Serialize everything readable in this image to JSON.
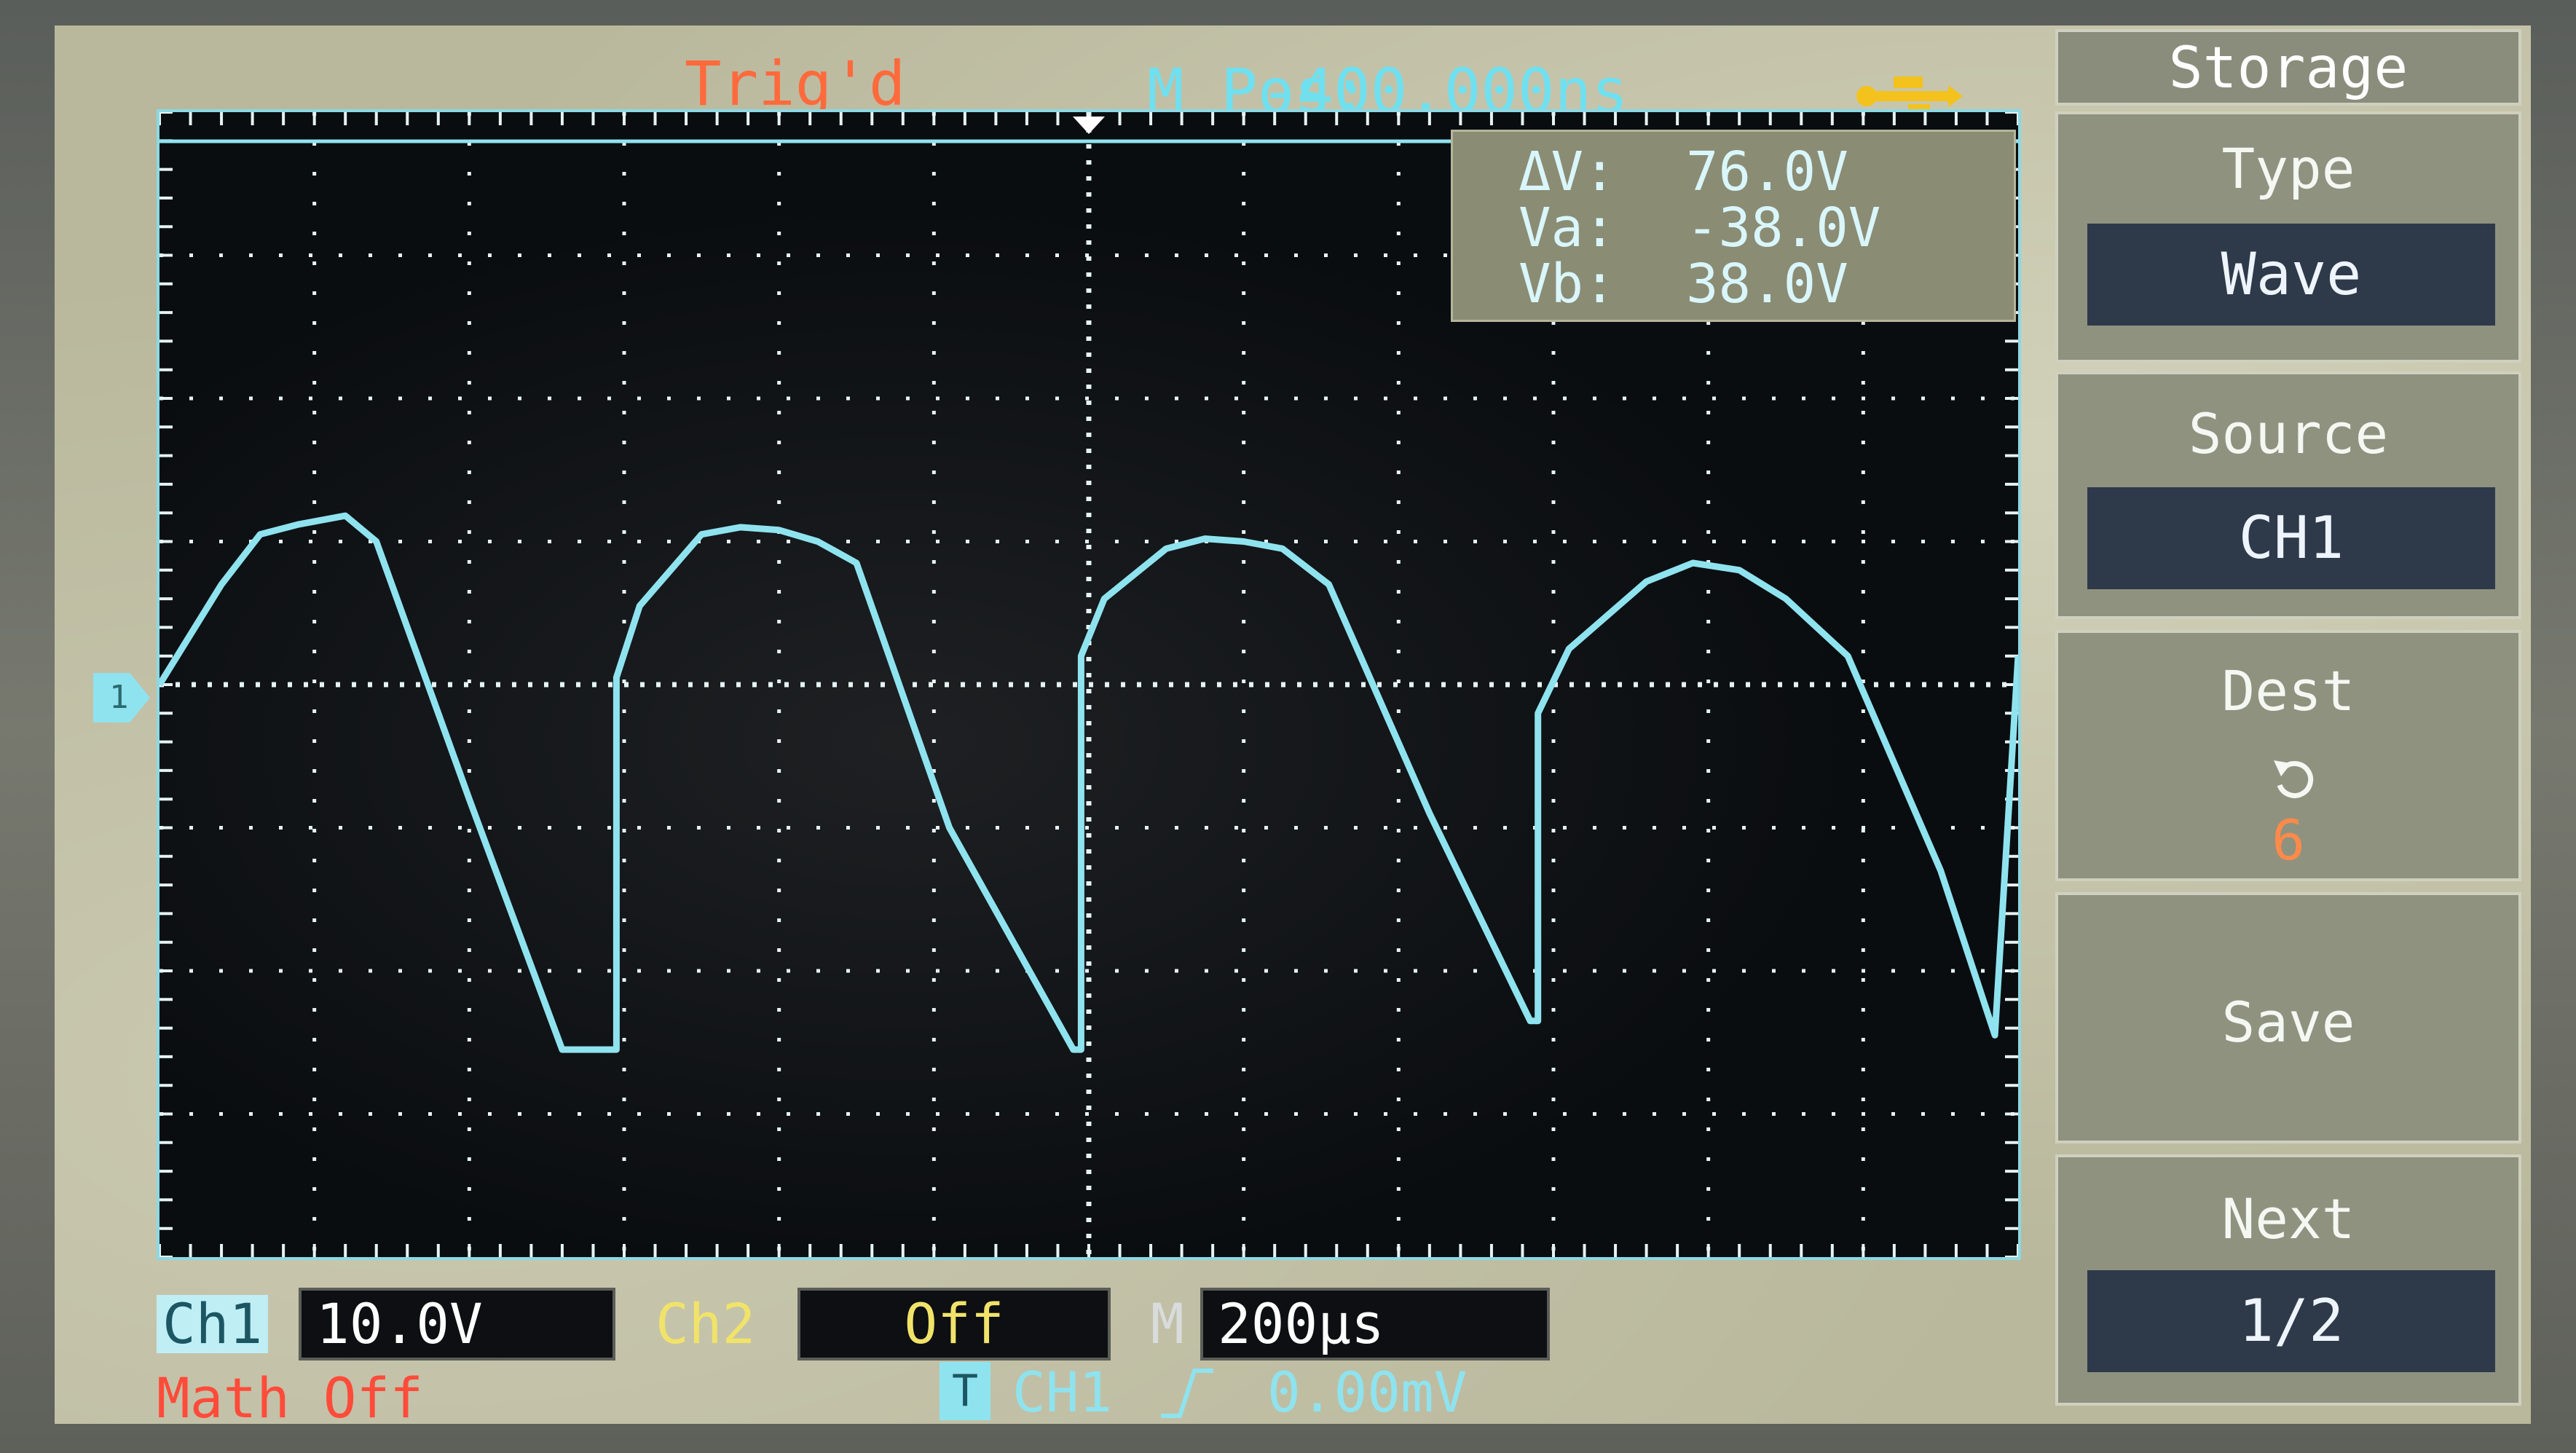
{
  "top_bar": {
    "trigger_status": "Trig'd",
    "horizontal_position_label": "M Pos:",
    "horizontal_position_value": "-400.000ns",
    "usb_icon": "usb-icon"
  },
  "cursor_readout": {
    "delta_label": "ΔV:",
    "delta_value": "76.0V",
    "va_label": "Va:",
    "va_value": "-38.0V",
    "vb_label": "Vb:",
    "vb_value": "38.0V"
  },
  "channel_marker": "1",
  "softkeys": {
    "menu_title": "Storage",
    "type_label": "Type",
    "type_value": "Wave",
    "source_label": "Source",
    "source_value": "CH1",
    "dest_label": "Dest",
    "dest_icon": "rotate-icon",
    "dest_value": "6",
    "save_label": "Save",
    "next_label": "Next",
    "next_value": "1/2"
  },
  "bottom_bar": {
    "ch1_label": "Ch1",
    "ch1_scale": "10.0V",
    "ch2_label": "Ch2",
    "ch2_scale": "Off",
    "timebase_label": "M",
    "timebase_value": "200µs",
    "math_status": "Math Off",
    "trigger_icon": "T",
    "trigger_source": "CH1",
    "trigger_slope_icon": "rising-edge-icon",
    "trigger_level": "0.00mV"
  },
  "colors": {
    "trace": "#8fe3ef",
    "trig_status": "#ff6a3c",
    "ch2": "#f1e36a",
    "math": "#ff4b3a",
    "dest_value": "#ff8a4a"
  },
  "chart_data": {
    "type": "line",
    "description_unit": "volts vs time",
    "time_per_div_us": 200,
    "volts_per_div": 10,
    "divisions": {
      "x": 12,
      "y": 8
    },
    "series": [
      {
        "x_div": [
          0.0,
          0.4,
          0.65,
          0.9,
          1.2,
          1.4,
          2.0,
          2.6,
          2.95,
          2.95,
          3.1,
          3.5,
          3.75,
          4.0,
          4.25,
          4.5,
          5.1,
          5.9,
          5.95,
          5.95,
          6.1,
          6.5,
          6.75,
          7.0,
          7.25,
          7.55,
          8.2,
          8.85,
          8.9,
          8.9,
          9.1,
          9.6,
          9.9,
          10.2,
          10.5,
          10.9,
          11.5,
          11.85,
          11.85,
          12.0
        ],
        "y_div": [
          0.0,
          0.7,
          1.05,
          1.12,
          1.18,
          1.0,
          -0.8,
          -2.55,
          -2.55,
          0.05,
          0.55,
          1.05,
          1.1,
          1.08,
          1.0,
          0.85,
          -1.0,
          -2.55,
          -2.55,
          0.2,
          0.6,
          0.95,
          1.02,
          1.0,
          0.95,
          0.7,
          -0.9,
          -2.35,
          -2.35,
          -0.2,
          0.25,
          0.72,
          0.85,
          0.8,
          0.6,
          0.2,
          -1.3,
          -2.45,
          -2.45,
          0.2
        ]
      }
    ]
  }
}
